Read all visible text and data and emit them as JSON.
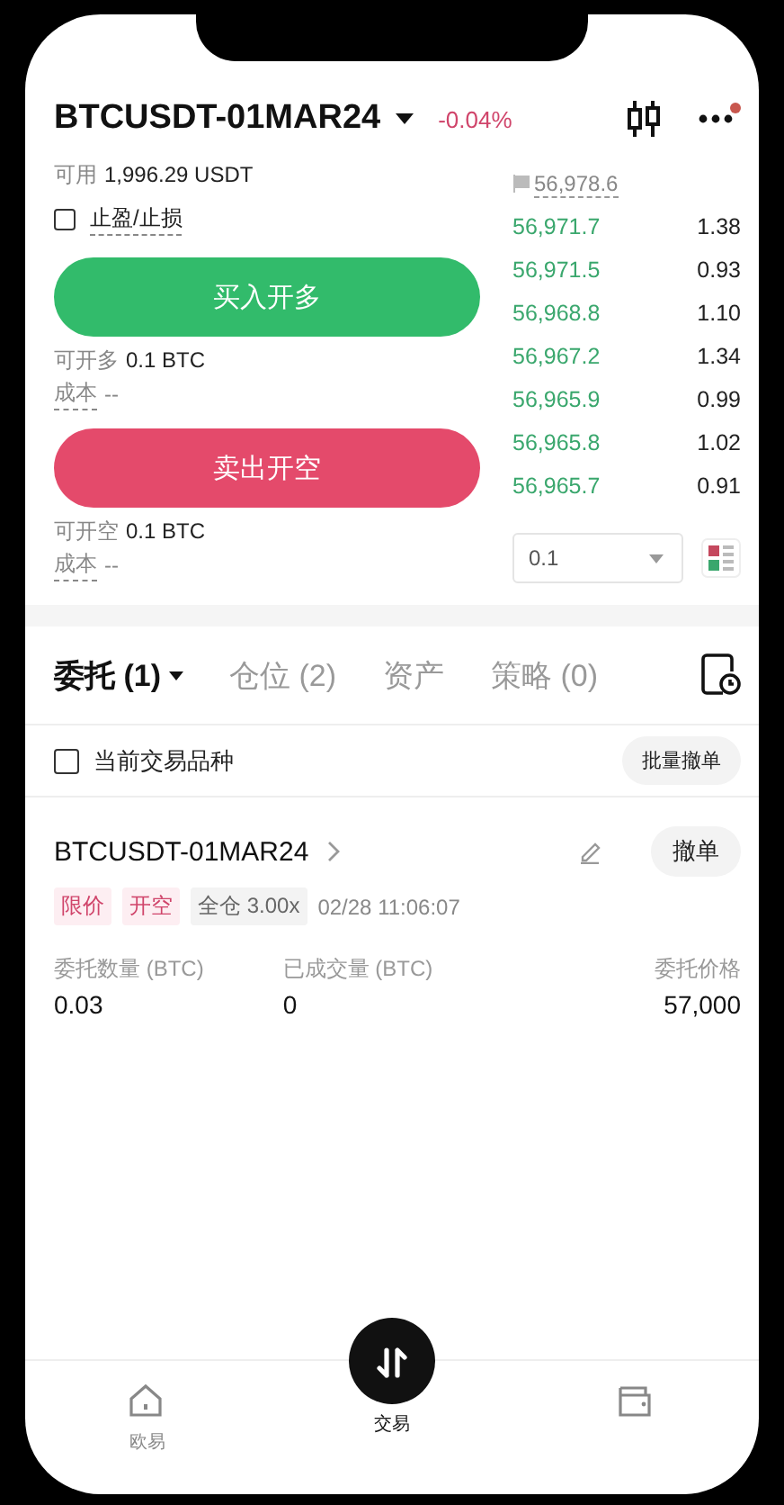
{
  "header": {
    "symbol": "BTCUSDT-01MAR24",
    "change": "-0.04%",
    "notification": true
  },
  "account": {
    "available_label": "可用",
    "available_value": "1,996.29 USDT",
    "tpsl": {
      "label": "止盈/止损",
      "checked": false
    }
  },
  "actions": [
    {
      "kind": "buy",
      "label": "买入开多",
      "max_label": "可开多",
      "max_value": "0.1 BTC",
      "cost_label": "成本",
      "cost_value": "--"
    },
    {
      "kind": "sell",
      "label": "卖出开空",
      "max_label": "可开空",
      "max_value": "0.1 BTC",
      "cost_label": "成本",
      "cost_value": "--"
    }
  ],
  "order_book": {
    "mark_price": "56,978.6",
    "rows": [
      {
        "price": "56,971.7",
        "size": "1.38"
      },
      {
        "price": "56,971.5",
        "size": "0.93"
      },
      {
        "price": "56,968.8",
        "size": "1.10"
      },
      {
        "price": "56,967.2",
        "size": "1.34"
      },
      {
        "price": "56,965.9",
        "size": "0.99"
      },
      {
        "price": "56,965.8",
        "size": "1.02"
      },
      {
        "price": "56,965.7",
        "size": "0.91"
      }
    ],
    "step": "0.1"
  },
  "tabs": [
    {
      "label": "委托 (1)",
      "selected": true,
      "kind": "dropdown"
    },
    {
      "label": "仓位 (2)",
      "selected": false,
      "kind": "plain"
    },
    {
      "label": "资产",
      "selected": false,
      "kind": "plain"
    },
    {
      "label": "策略 (0)",
      "selected": false,
      "kind": "plain"
    }
  ],
  "filter": {
    "label": "当前交易品种",
    "checked": false,
    "button": "批量撤单"
  },
  "orders": [
    {
      "symbol": "BTCUSDT-01MAR24",
      "tags": [
        {
          "text": "限价",
          "kind": "side"
        },
        {
          "text": "开空",
          "kind": "side"
        },
        {
          "text": "全仓 3.00x",
          "kind": "mode"
        }
      ],
      "time": "02/28 11:06:07",
      "cancel": "撤单",
      "fields": [
        {
          "label": "委托数量 (BTC)",
          "value": "0.03"
        },
        {
          "label": "已成交量 (BTC)",
          "value": "0"
        },
        {
          "label": "委托价格",
          "value": "57,000"
        }
      ]
    }
  ],
  "nav": [
    {
      "kind": "home",
      "label": "欧易",
      "selected": false
    },
    {
      "kind": "trade",
      "label": "交易",
      "selected": true
    },
    {
      "kind": "wallet",
      "selected": false
    }
  ]
}
